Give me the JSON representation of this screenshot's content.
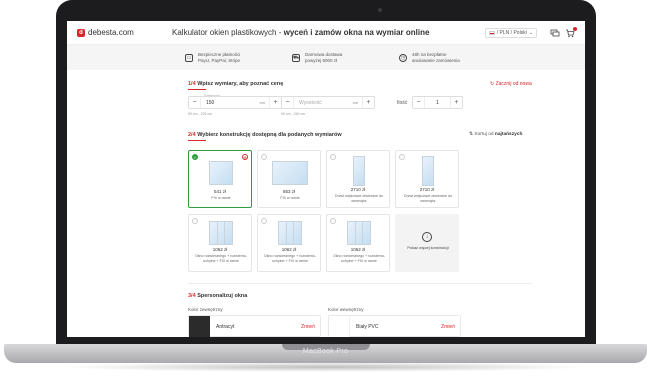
{
  "laptop": {
    "model": "MacBook Pro"
  },
  "header": {
    "logo_text": "debesta.com",
    "title_plain": "Kalkulator okien plastikowych - ",
    "title_bold": "wyceń i zamów okna na wymiar online",
    "language": "/ PLN / Polski",
    "icons": [
      "flag-pl-icon",
      "chat-icon",
      "cart-icon"
    ]
  },
  "benefits": [
    {
      "icon": "payment-icon",
      "line1": "Bezpieczne płatności",
      "line2": "PayU, PayPal, Stripe"
    },
    {
      "icon": "truck-icon",
      "line1": "Darmowa dostawa",
      "line2": "powyżej 6000 zł"
    },
    {
      "icon": "clock-icon",
      "line1": "48h na bezpłatne",
      "line2": "anulowanie zamówienia"
    }
  ],
  "step1": {
    "num": "1/4",
    "title": "Wpisz wymiary, aby poznać cenę",
    "reset_link": "Zacznij od nowa",
    "width": {
      "label": "Szerokość",
      "value": "150",
      "unit": "cm",
      "range": "50 cm - 226 cm"
    },
    "height": {
      "placeholder": "Wysokość",
      "unit": "cm",
      "range": "50 cm - 240 cm"
    },
    "separator": "x",
    "quantity": {
      "label": "Ilość",
      "value": "1"
    }
  },
  "step2": {
    "num": "2/4",
    "title": "Wybierz konstrukcję dostępną dla podanych wymiarów",
    "sort_prefix": "Sortuj od",
    "sort_value": "najtańszych",
    "cards": [
      {
        "price": "541 zł",
        "desc": "FIX w ramie"
      },
      {
        "price": "853 zł",
        "desc": "FIX w ramie"
      },
      {
        "price": "2710 zł",
        "desc": "Drzwi wejściowe otwierane do wewnątrz"
      },
      {
        "price": "2710 zł",
        "desc": "Drzwi wejściowe otwierane do wewnątrz"
      },
      {
        "price": "1062 zł",
        "desc": "Okno rozwieranego + rozwierno-uchylne + FIX w ramie"
      },
      {
        "price": "1062 zł",
        "desc": "Okno rozwieranego + rozwierno-uchylne + FIX w ramie"
      },
      {
        "price": "1062 zł",
        "desc": "Okno rozwieranego + rozwierno-uchylne + FIX w ramie"
      }
    ],
    "more_label": "Pokaż więcej konstrukcji"
  },
  "step3": {
    "num": "3/4",
    "title": "Spersonalizuj okna",
    "outer_label": "Kolor zewnętrzny",
    "outer_value": "Antracyt",
    "outer_color": "#2b2b2b",
    "inner_label": "Kolor wewnętrzny",
    "inner_value": "Biały PVC",
    "inner_color": "#ffffff",
    "change_label": "Zmień"
  },
  "colors": {
    "accent": "#d62828",
    "selected": "#2e9e3e"
  }
}
